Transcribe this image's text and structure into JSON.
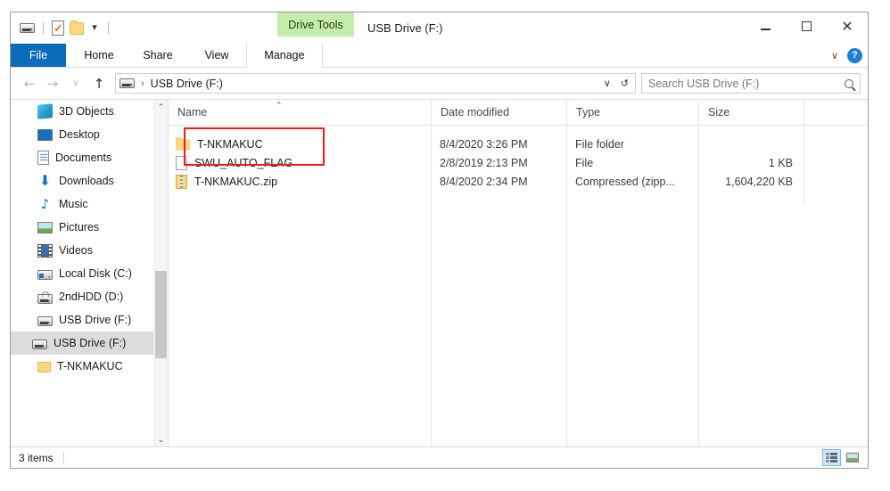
{
  "window": {
    "title": "USB Drive (F:)",
    "contextual_tab_group": "Drive Tools",
    "quick_access": [
      {
        "icon": "usb-drive-icon",
        "name": "drive-properties"
      },
      {
        "icon": "properties-checkmark-icon",
        "name": "properties"
      },
      {
        "icon": "new-folder-icon",
        "name": "new-folder"
      },
      {
        "icon": "chevron-down-icon",
        "name": "customize-quick-access"
      }
    ],
    "controls": {
      "minimize": "–",
      "maximize": "□",
      "close": "✕"
    }
  },
  "ribbon": {
    "tabs": [
      {
        "label": "File",
        "active": true
      },
      {
        "label": "Home",
        "active": false
      },
      {
        "label": "Share",
        "active": false
      },
      {
        "label": "View",
        "active": false
      },
      {
        "label": "Manage",
        "active": false
      }
    ],
    "collapse_chevron": "∨",
    "help_label": "?"
  },
  "address": {
    "back": "←",
    "forward": "→",
    "recent": "∨",
    "up": "↑",
    "crumb_separator": "›",
    "path": "USB Drive (F:)",
    "dropdown": "∨",
    "refresh": "↺"
  },
  "search": {
    "placeholder": "Search USB Drive (F:)"
  },
  "sidebar": {
    "items": [
      {
        "label": "3D Objects",
        "icon": "3d-objects-icon",
        "selected": false
      },
      {
        "label": "Desktop",
        "icon": "desktop-icon",
        "selected": false
      },
      {
        "label": "Documents",
        "icon": "documents-icon",
        "selected": false
      },
      {
        "label": "Downloads",
        "icon": "downloads-icon",
        "selected": false
      },
      {
        "label": "Music",
        "icon": "music-icon",
        "selected": false
      },
      {
        "label": "Pictures",
        "icon": "pictures-icon",
        "selected": false
      },
      {
        "label": "Videos",
        "icon": "videos-icon",
        "selected": false
      },
      {
        "label": "Local Disk (C:)",
        "icon": "hard-drive-icon",
        "selected": false
      },
      {
        "label": "2ndHDD (D:)",
        "icon": "locked-drive-icon",
        "selected": false
      },
      {
        "label": "USB Drive (F:)",
        "icon": "usb-drive-icon",
        "selected": false
      },
      {
        "label": "USB Drive (F:)",
        "icon": "usb-drive-icon",
        "selected": true
      },
      {
        "label": "T-NKMAKUC",
        "icon": "folder-icon",
        "selected": false
      }
    ],
    "scroll_up": "⌃",
    "scroll_down": "⌄"
  },
  "filelist": {
    "columns": [
      {
        "label": "Name",
        "sorted": true,
        "sort_indicator": "⌃"
      },
      {
        "label": "Date modified",
        "sorted": false
      },
      {
        "label": "Type",
        "sorted": false
      },
      {
        "label": "Size",
        "sorted": false
      }
    ],
    "rows": [
      {
        "name": "T-NKMAKUC",
        "icon": "folder-icon",
        "date": "8/4/2020 3:26 PM",
        "type": "File folder",
        "size": ""
      },
      {
        "name": "SWU_AUTO_FLAG",
        "icon": "generic-file-icon",
        "date": "2/8/2019 2:13 PM",
        "type": "File",
        "size": "1 KB"
      },
      {
        "name": "T-NKMAKUC.zip",
        "icon": "zip-file-icon",
        "date": "8/4/2020 2:34 PM",
        "type": "Compressed (zipp...",
        "size": "1,604,220 KB"
      }
    ],
    "annotation": {
      "color": "#ee1c1c",
      "covers": [
        "T-NKMAKUC",
        "SWU_AUTO_FLAG"
      ]
    }
  },
  "statusbar": {
    "item_count": "3 items",
    "views": [
      {
        "name": "details-view",
        "active": true
      },
      {
        "name": "large-icons-view",
        "active": false
      }
    ]
  },
  "colors": {
    "file_tab_blue": "#0d6cb9",
    "contextual_green": "#c5ebad",
    "annotation_red": "#ee1c1c",
    "selection_gray": "#dcdcdc"
  }
}
